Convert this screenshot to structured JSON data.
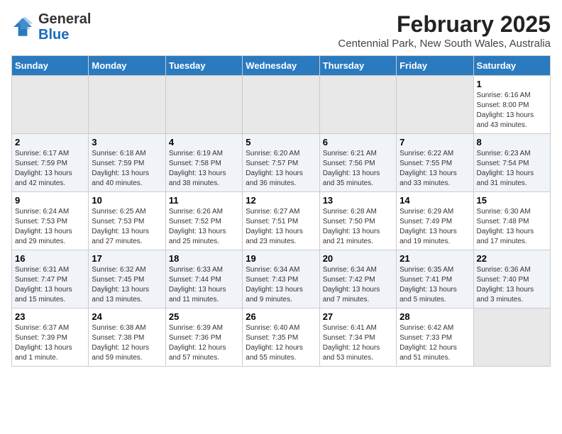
{
  "logo": {
    "general": "General",
    "blue": "Blue"
  },
  "title": "February 2025",
  "subtitle": "Centennial Park, New South Wales, Australia",
  "days_of_week": [
    "Sunday",
    "Monday",
    "Tuesday",
    "Wednesday",
    "Thursday",
    "Friday",
    "Saturday"
  ],
  "weeks": [
    [
      {
        "num": "",
        "detail": ""
      },
      {
        "num": "",
        "detail": ""
      },
      {
        "num": "",
        "detail": ""
      },
      {
        "num": "",
        "detail": ""
      },
      {
        "num": "",
        "detail": ""
      },
      {
        "num": "",
        "detail": ""
      },
      {
        "num": "1",
        "detail": "Sunrise: 6:16 AM\nSunset: 8:00 PM\nDaylight: 13 hours\nand 43 minutes."
      }
    ],
    [
      {
        "num": "2",
        "detail": "Sunrise: 6:17 AM\nSunset: 7:59 PM\nDaylight: 13 hours\nand 42 minutes."
      },
      {
        "num": "3",
        "detail": "Sunrise: 6:18 AM\nSunset: 7:59 PM\nDaylight: 13 hours\nand 40 minutes."
      },
      {
        "num": "4",
        "detail": "Sunrise: 6:19 AM\nSunset: 7:58 PM\nDaylight: 13 hours\nand 38 minutes."
      },
      {
        "num": "5",
        "detail": "Sunrise: 6:20 AM\nSunset: 7:57 PM\nDaylight: 13 hours\nand 36 minutes."
      },
      {
        "num": "6",
        "detail": "Sunrise: 6:21 AM\nSunset: 7:56 PM\nDaylight: 13 hours\nand 35 minutes."
      },
      {
        "num": "7",
        "detail": "Sunrise: 6:22 AM\nSunset: 7:55 PM\nDaylight: 13 hours\nand 33 minutes."
      },
      {
        "num": "8",
        "detail": "Sunrise: 6:23 AM\nSunset: 7:54 PM\nDaylight: 13 hours\nand 31 minutes."
      }
    ],
    [
      {
        "num": "9",
        "detail": "Sunrise: 6:24 AM\nSunset: 7:53 PM\nDaylight: 13 hours\nand 29 minutes."
      },
      {
        "num": "10",
        "detail": "Sunrise: 6:25 AM\nSunset: 7:53 PM\nDaylight: 13 hours\nand 27 minutes."
      },
      {
        "num": "11",
        "detail": "Sunrise: 6:26 AM\nSunset: 7:52 PM\nDaylight: 13 hours\nand 25 minutes."
      },
      {
        "num": "12",
        "detail": "Sunrise: 6:27 AM\nSunset: 7:51 PM\nDaylight: 13 hours\nand 23 minutes."
      },
      {
        "num": "13",
        "detail": "Sunrise: 6:28 AM\nSunset: 7:50 PM\nDaylight: 13 hours\nand 21 minutes."
      },
      {
        "num": "14",
        "detail": "Sunrise: 6:29 AM\nSunset: 7:49 PM\nDaylight: 13 hours\nand 19 minutes."
      },
      {
        "num": "15",
        "detail": "Sunrise: 6:30 AM\nSunset: 7:48 PM\nDaylight: 13 hours\nand 17 minutes."
      }
    ],
    [
      {
        "num": "16",
        "detail": "Sunrise: 6:31 AM\nSunset: 7:47 PM\nDaylight: 13 hours\nand 15 minutes."
      },
      {
        "num": "17",
        "detail": "Sunrise: 6:32 AM\nSunset: 7:45 PM\nDaylight: 13 hours\nand 13 minutes."
      },
      {
        "num": "18",
        "detail": "Sunrise: 6:33 AM\nSunset: 7:44 PM\nDaylight: 13 hours\nand 11 minutes."
      },
      {
        "num": "19",
        "detail": "Sunrise: 6:34 AM\nSunset: 7:43 PM\nDaylight: 13 hours\nand 9 minutes."
      },
      {
        "num": "20",
        "detail": "Sunrise: 6:34 AM\nSunset: 7:42 PM\nDaylight: 13 hours\nand 7 minutes."
      },
      {
        "num": "21",
        "detail": "Sunrise: 6:35 AM\nSunset: 7:41 PM\nDaylight: 13 hours\nand 5 minutes."
      },
      {
        "num": "22",
        "detail": "Sunrise: 6:36 AM\nSunset: 7:40 PM\nDaylight: 13 hours\nand 3 minutes."
      }
    ],
    [
      {
        "num": "23",
        "detail": "Sunrise: 6:37 AM\nSunset: 7:39 PM\nDaylight: 13 hours\nand 1 minute."
      },
      {
        "num": "24",
        "detail": "Sunrise: 6:38 AM\nSunset: 7:38 PM\nDaylight: 12 hours\nand 59 minutes."
      },
      {
        "num": "25",
        "detail": "Sunrise: 6:39 AM\nSunset: 7:36 PM\nDaylight: 12 hours\nand 57 minutes."
      },
      {
        "num": "26",
        "detail": "Sunrise: 6:40 AM\nSunset: 7:35 PM\nDaylight: 12 hours\nand 55 minutes."
      },
      {
        "num": "27",
        "detail": "Sunrise: 6:41 AM\nSunset: 7:34 PM\nDaylight: 12 hours\nand 53 minutes."
      },
      {
        "num": "28",
        "detail": "Sunrise: 6:42 AM\nSunset: 7:33 PM\nDaylight: 12 hours\nand 51 minutes."
      },
      {
        "num": "",
        "detail": ""
      }
    ]
  ]
}
